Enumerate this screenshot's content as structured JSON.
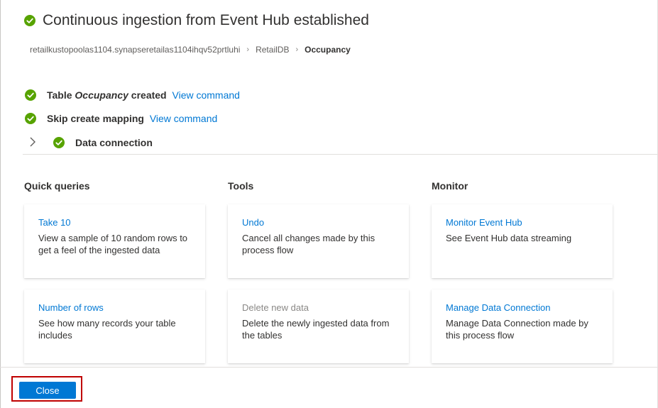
{
  "header": {
    "title": "Continuous ingestion from Event Hub established"
  },
  "breadcrumb": {
    "items": [
      "retailkustopoolas1104.synapseretailas1104ihqv52prtluhi",
      "RetailDB"
    ],
    "current": "Occupancy"
  },
  "steps": {
    "table": {
      "prefix": "Table ",
      "name": "Occupancy",
      "suffix": " created",
      "link": "View command"
    },
    "mapping": {
      "label": "Skip create mapping",
      "link": "View command"
    },
    "connection": {
      "label": "Data connection"
    }
  },
  "sections": {
    "quick_queries": {
      "title": "Quick queries",
      "cards": [
        {
          "title": "Take 10",
          "desc": "View a sample of 10 random rows to get a feel of the ingested data"
        },
        {
          "title": "Number of rows",
          "desc": "See how many records your table includes"
        }
      ]
    },
    "tools": {
      "title": "Tools",
      "cards": [
        {
          "title": "Undo",
          "desc": "Cancel all changes made by this process flow"
        },
        {
          "title": "Delete new data",
          "desc": "Delete the newly ingested data from the tables"
        }
      ]
    },
    "monitor": {
      "title": "Monitor",
      "cards": [
        {
          "title": "Monitor Event Hub",
          "desc": "See Event Hub data streaming"
        },
        {
          "title": "Manage Data Connection",
          "desc": "Manage Data Connection made by this process flow"
        }
      ]
    }
  },
  "footer": {
    "close_label": "Close"
  },
  "colors": {
    "accent": "#0078d4",
    "success": "#57a300",
    "highlight": "#c00000"
  }
}
